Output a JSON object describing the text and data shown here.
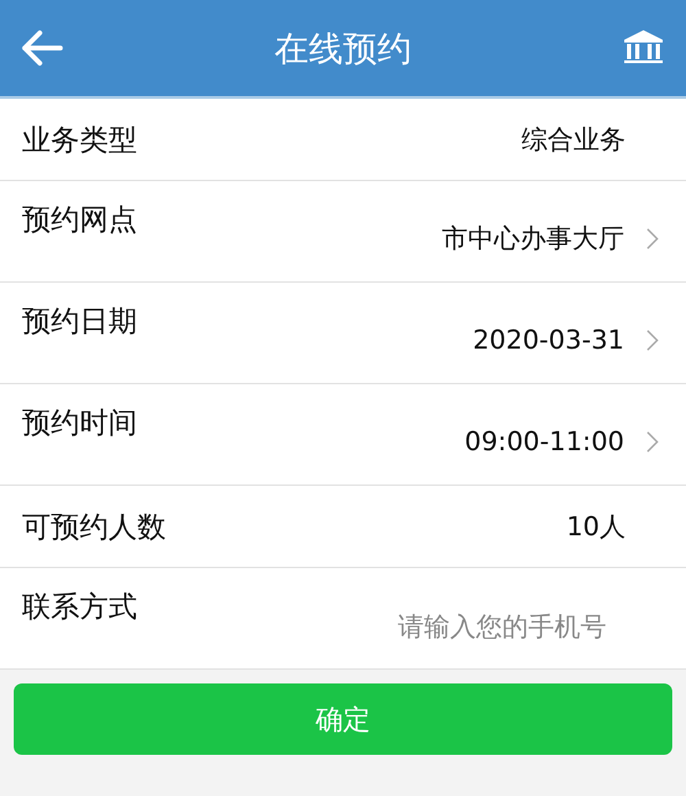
{
  "header": {
    "title": "在线预约"
  },
  "rows": [
    {
      "kind": "static",
      "label": "业务类型",
      "value": "综合业务"
    },
    {
      "kind": "select",
      "label": "预约网点",
      "value": "市中心办事大厅"
    },
    {
      "kind": "select",
      "label": "预约日期",
      "value": "2020-03-31"
    },
    {
      "kind": "select",
      "label": "预约时间",
      "value": "09:00-11:00"
    },
    {
      "kind": "static",
      "label": "可预约人数",
      "value": "10人"
    },
    {
      "kind": "input",
      "label": "联系方式",
      "placeholder": "请输入您的手机号"
    }
  ],
  "submit": "确定"
}
